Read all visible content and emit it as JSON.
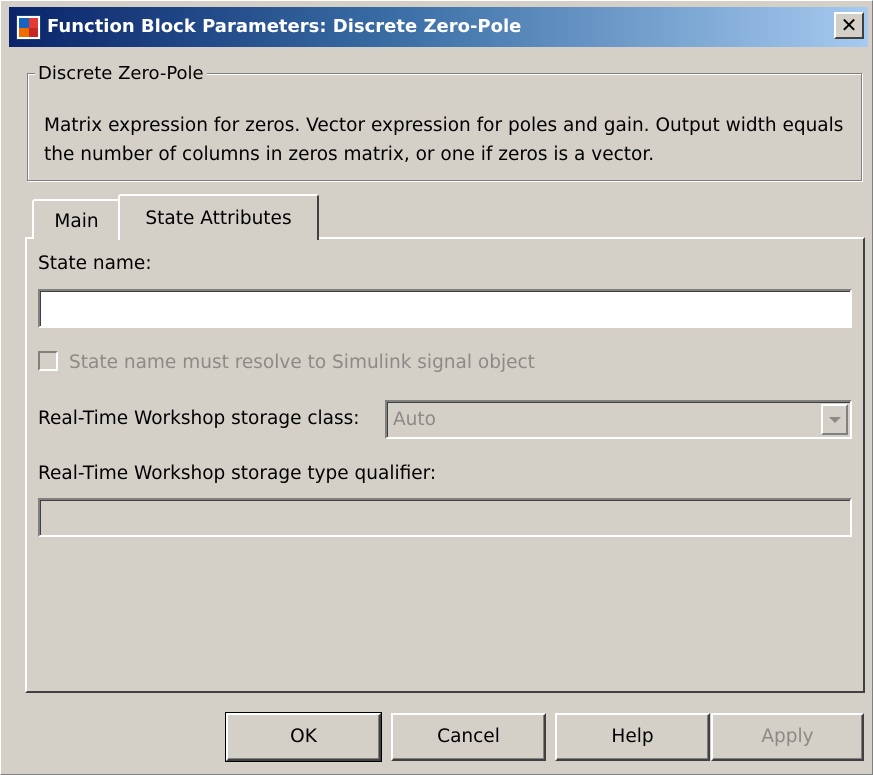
{
  "window": {
    "title": "Function Block Parameters: Discrete Zero-Pole",
    "close_glyph": "✕"
  },
  "group": {
    "label": "Discrete Zero-Pole",
    "description": "Matrix expression for zeros.  Vector expression for poles and gain. Output width equals the number of columns in zeros matrix, or one if zeros is a vector."
  },
  "tabs": [
    {
      "label": "Main",
      "active": false
    },
    {
      "label": "State Attributes",
      "active": true
    }
  ],
  "state_attributes": {
    "state_name_label": "State name:",
    "state_name_value": "",
    "resolve_checkbox_label": "State name must resolve to Simulink signal object",
    "resolve_checkbox_checked": false,
    "storage_class_label": "Real-Time Workshop storage class:",
    "storage_class_value": "Auto",
    "type_qualifier_label": "Real-Time Workshop storage type qualifier:",
    "type_qualifier_value": ""
  },
  "buttons": {
    "ok": "OK",
    "cancel": "Cancel",
    "help": "Help",
    "apply": "Apply"
  },
  "colors": {
    "window_bg": "#d4d0c8",
    "titlebar_start": "#0a246a",
    "titlebar_end": "#a6caf0",
    "disabled_text": "#8c8a86"
  }
}
